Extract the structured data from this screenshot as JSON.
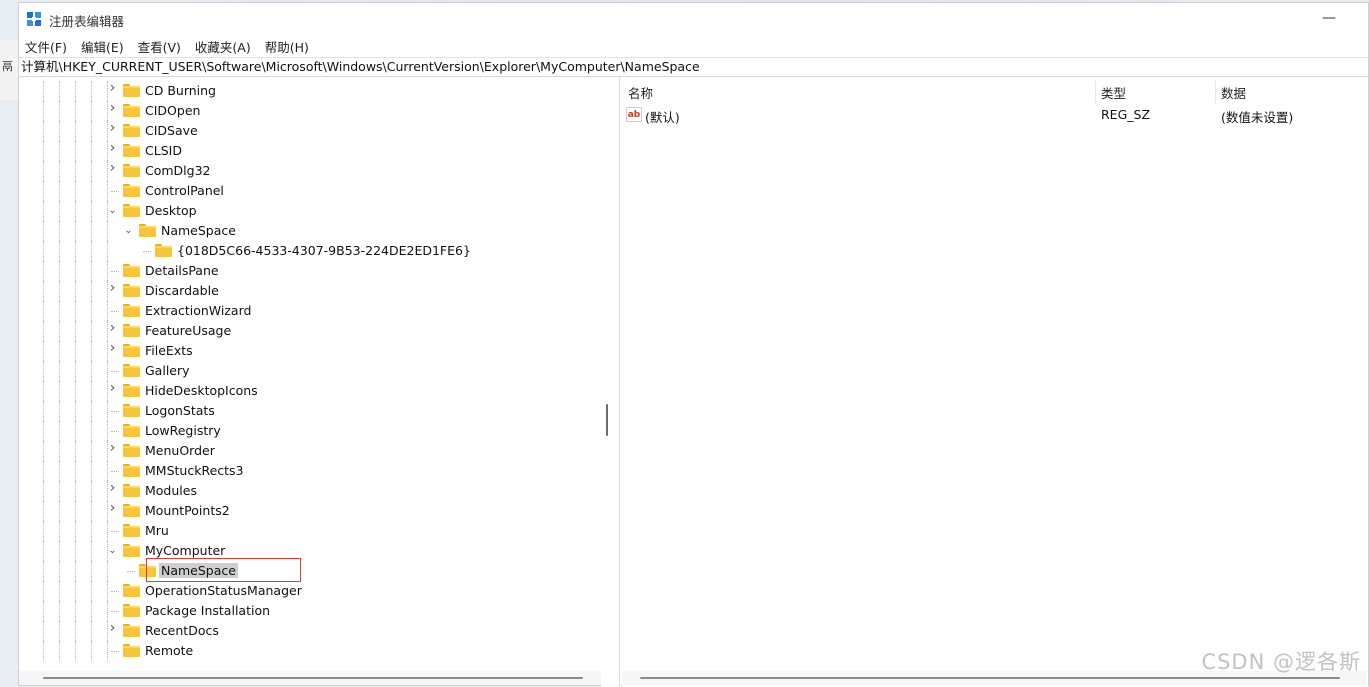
{
  "window": {
    "title": "注册表编辑器",
    "minimize_glyph": "—"
  },
  "left_edge_text": "鬲",
  "menubar": [
    "文件(F)",
    "编辑(E)",
    "查看(V)",
    "收藏夹(A)",
    "帮助(H)"
  ],
  "address": "计算机\\HKEY_CURRENT_USER\\Software\\Microsoft\\Windows\\CurrentVersion\\Explorer\\MyComputer\\NameSpace",
  "tree": [
    {
      "label": "CD Burning",
      "expander": "collapsed"
    },
    {
      "label": "CIDOpen",
      "expander": "collapsed"
    },
    {
      "label": "CIDSave",
      "expander": "collapsed"
    },
    {
      "label": "CLSID",
      "expander": "collapsed"
    },
    {
      "label": "ComDlg32",
      "expander": "collapsed"
    },
    {
      "label": "ControlPanel",
      "expander": "none"
    },
    {
      "label": "Desktop",
      "expander": "expanded"
    },
    {
      "label": "NameSpace",
      "expander": "expanded"
    },
    {
      "label": "{018D5C66-4533-4307-9B53-224DE2ED1FE6}",
      "expander": "none"
    },
    {
      "label": "DetailsPane",
      "expander": "none"
    },
    {
      "label": "Discardable",
      "expander": "collapsed"
    },
    {
      "label": "ExtractionWizard",
      "expander": "none"
    },
    {
      "label": "FeatureUsage",
      "expander": "collapsed"
    },
    {
      "label": "FileExts",
      "expander": "collapsed"
    },
    {
      "label": "Gallery",
      "expander": "none"
    },
    {
      "label": "HideDesktopIcons",
      "expander": "collapsed"
    },
    {
      "label": "LogonStats",
      "expander": "none"
    },
    {
      "label": "LowRegistry",
      "expander": "none"
    },
    {
      "label": "MenuOrder",
      "expander": "collapsed"
    },
    {
      "label": "MMStuckRects3",
      "expander": "none"
    },
    {
      "label": "Modules",
      "expander": "collapsed"
    },
    {
      "label": "MountPoints2",
      "expander": "collapsed"
    },
    {
      "label": "Mru",
      "expander": "none"
    },
    {
      "label": "MyComputer",
      "expander": "expanded"
    },
    {
      "label": "NameSpace",
      "expander": "none",
      "selected": true
    },
    {
      "label": "OperationStatusManager",
      "expander": "none"
    },
    {
      "label": "Package Installation",
      "expander": "none"
    },
    {
      "label": "RecentDocs",
      "expander": "collapsed"
    },
    {
      "label": "Remote",
      "expander": "none"
    }
  ],
  "list": {
    "columns": [
      "名称",
      "类型",
      "数据"
    ],
    "rows": [
      {
        "name": "(默认)",
        "type": "REG_SZ",
        "data": "(数值未设置)",
        "icon": "string-value-icon"
      }
    ]
  },
  "watermark": "CSDN @逻各斯",
  "colors": {
    "folder": "#f6c53d",
    "selection": "#cfcfcf",
    "highlight_box": "#d93a3a"
  }
}
